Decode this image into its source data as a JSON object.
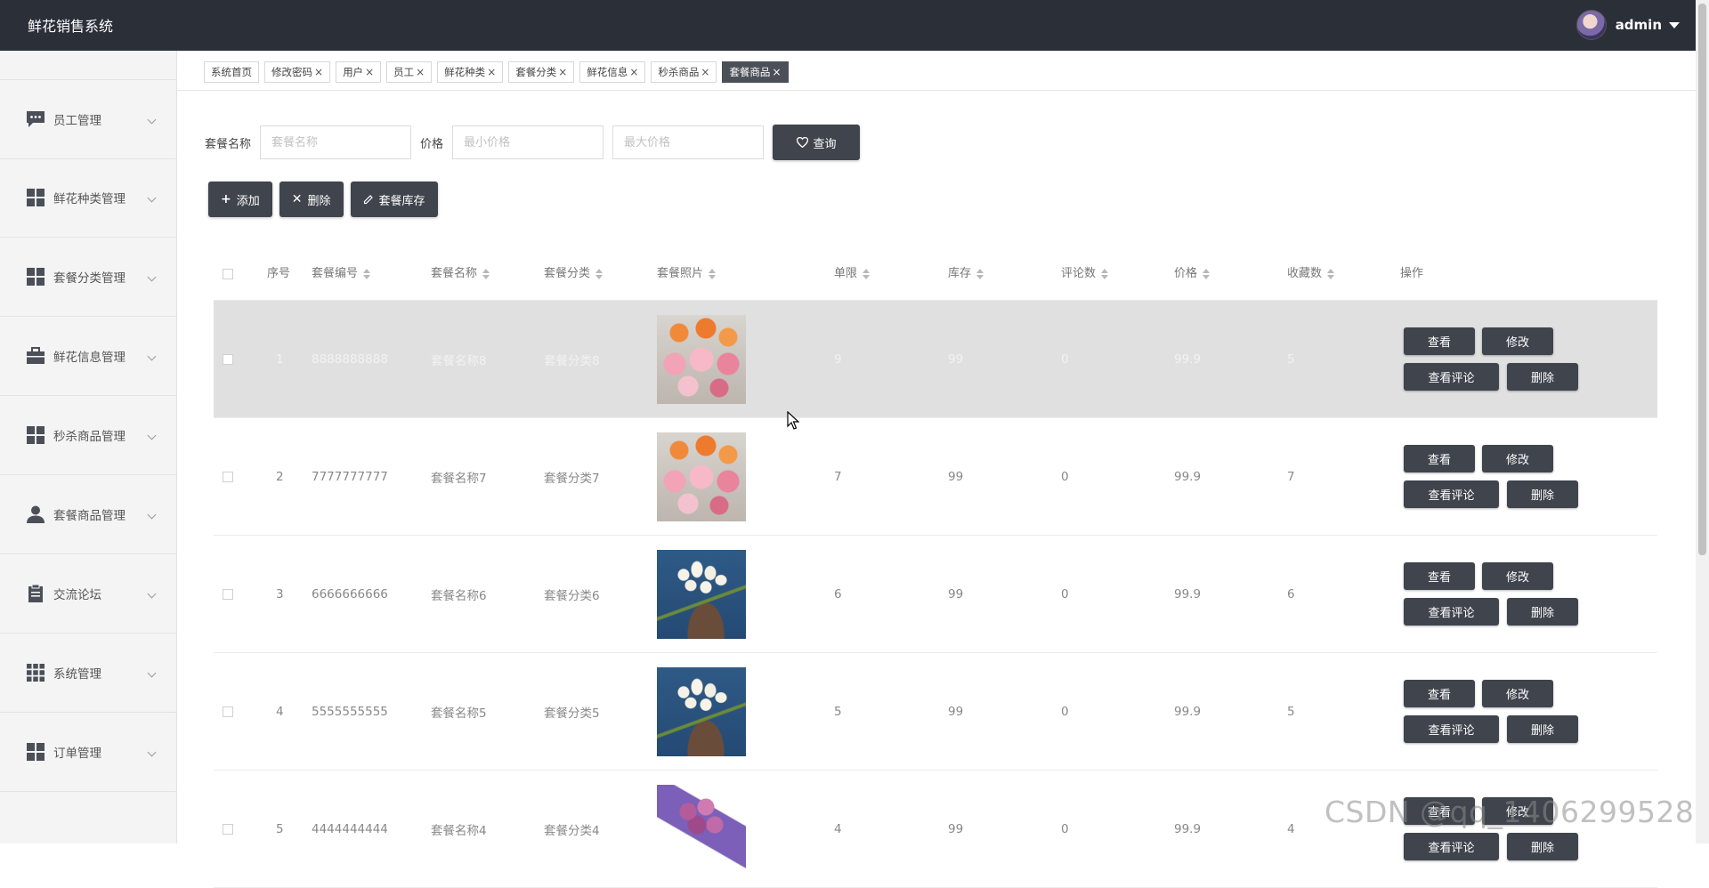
{
  "app": {
    "title": "鲜花销售系统",
    "user_name": "admin"
  },
  "sidebar": {
    "items": [
      {
        "label": "员工管理",
        "icon": "chat-bubble-icon"
      },
      {
        "label": "鲜花种类管理",
        "icon": "grid-icon"
      },
      {
        "label": "套餐分类管理",
        "icon": "grid-icon"
      },
      {
        "label": "鲜花信息管理",
        "icon": "briefcase-icon"
      },
      {
        "label": "秒杀商品管理",
        "icon": "grid-icon"
      },
      {
        "label": "套餐商品管理",
        "icon": "user-icon"
      },
      {
        "label": "交流论坛",
        "icon": "clipboard-icon"
      },
      {
        "label": "系统管理",
        "icon": "apps-icon"
      },
      {
        "label": "订单管理",
        "icon": "grid-icon"
      }
    ]
  },
  "tabs": [
    {
      "label": "系统首页",
      "closable": false,
      "active": false
    },
    {
      "label": "修改密码",
      "closable": true,
      "active": false
    },
    {
      "label": "用户",
      "closable": true,
      "active": false
    },
    {
      "label": "员工",
      "closable": true,
      "active": false
    },
    {
      "label": "鲜花种类",
      "closable": true,
      "active": false
    },
    {
      "label": "套餐分类",
      "closable": true,
      "active": false
    },
    {
      "label": "鲜花信息",
      "closable": true,
      "active": false
    },
    {
      "label": "秒杀商品",
      "closable": true,
      "active": false
    },
    {
      "label": "套餐商品",
      "closable": true,
      "active": true
    }
  ],
  "tab_close_glyph": "×",
  "search": {
    "name_label": "套餐名称",
    "name_placeholder": "套餐名称",
    "name_value": "",
    "price_label": "价格",
    "min_price_placeholder": "最小价格",
    "max_price_placeholder": "最大价格",
    "query_button": "查询"
  },
  "actions": {
    "add": "添加",
    "delete": "删除",
    "stock": "套餐库存"
  },
  "table": {
    "headers": {
      "index": "序号",
      "code": "套餐编号",
      "name": "套餐名称",
      "category": "套餐分类",
      "photo": "套餐照片",
      "limit": "单限",
      "stock": "库存",
      "comments": "评论数",
      "price": "价格",
      "favorites": "收藏数",
      "ops": "操作"
    },
    "rows": [
      {
        "index": "1",
        "code": "8888888888",
        "name": "套餐名称8",
        "category": "套餐分类8",
        "photo": "flowers-a",
        "limit": "9",
        "stock": "99",
        "comments": "0",
        "price": "99.9",
        "favorites": "5"
      },
      {
        "index": "2",
        "code": "7777777777",
        "name": "套餐名称7",
        "category": "套餐分类7",
        "photo": "flowers-a",
        "limit": "7",
        "stock": "99",
        "comments": "0",
        "price": "99.9",
        "favorites": "7"
      },
      {
        "index": "3",
        "code": "6666666666",
        "name": "套餐名称6",
        "category": "套餐分类6",
        "photo": "flowers-b",
        "limit": "6",
        "stock": "99",
        "comments": "0",
        "price": "99.9",
        "favorites": "6"
      },
      {
        "index": "4",
        "code": "5555555555",
        "name": "套餐名称5",
        "category": "套餐分类5",
        "photo": "flowers-b",
        "limit": "5",
        "stock": "99",
        "comments": "0",
        "price": "99.9",
        "favorites": "5"
      },
      {
        "index": "5",
        "code": "4444444444",
        "name": "套餐名称4",
        "category": "套餐分类4",
        "photo": "flowers-c",
        "limit": "4",
        "stock": "99",
        "comments": "0",
        "price": "99.9",
        "favorites": "4"
      }
    ],
    "row_actions": {
      "view": "查看",
      "edit": "修改",
      "comments": "查看评论",
      "delete": "删除"
    }
  },
  "watermark": "CSDN @qq_1406299528",
  "colors": {
    "header_bg": "#2b2f38",
    "button_bg": "#3f444d",
    "active_tab": "#4a4f58",
    "hover_row": "#e0e0e0"
  }
}
